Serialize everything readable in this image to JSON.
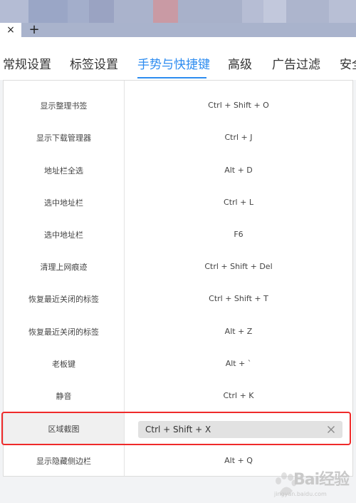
{
  "browser": {
    "close_tab_glyph": "×",
    "new_tab_glyph": "+"
  },
  "nav": {
    "items": [
      {
        "label": "常规设置",
        "active": false
      },
      {
        "label": "标签设置",
        "active": false
      },
      {
        "label": "手势与快捷键",
        "active": true
      },
      {
        "label": "高级",
        "active": false
      },
      {
        "label": "广告过滤",
        "active": false
      },
      {
        "label": "安全",
        "active": false
      }
    ],
    "active_color": "#2d8cf0"
  },
  "shortcuts": [
    {
      "name": "显示整理书签",
      "key": "Ctrl + Shift + O"
    },
    {
      "name": "显示下载管理器",
      "key": "Ctrl + J"
    },
    {
      "name": "地址栏全选",
      "key": "Alt + D"
    },
    {
      "name": "选中地址栏",
      "key": "Ctrl + L"
    },
    {
      "name": "选中地址栏",
      "key": "F6"
    },
    {
      "name": "清理上网痕迹",
      "key": "Ctrl + Shift + Del"
    },
    {
      "name": "恢复最近关闭的标签",
      "key": "Ctrl + Shift + T"
    },
    {
      "name": "恢复最近关闭的标签",
      "key": "Alt + Z"
    },
    {
      "name": "老板键",
      "key": "Alt + `"
    },
    {
      "name": "静音",
      "key": "Ctrl + K"
    },
    {
      "name": "区域截图",
      "key": "Ctrl + Shift + X",
      "editing": true
    },
    {
      "name": "显示隐藏侧边栏",
      "key": "Alt + Q"
    }
  ],
  "highlight_color": "#ef2a2a",
  "watermark": {
    "text": "Bai经验",
    "url": "jingyan.baidu.com"
  }
}
